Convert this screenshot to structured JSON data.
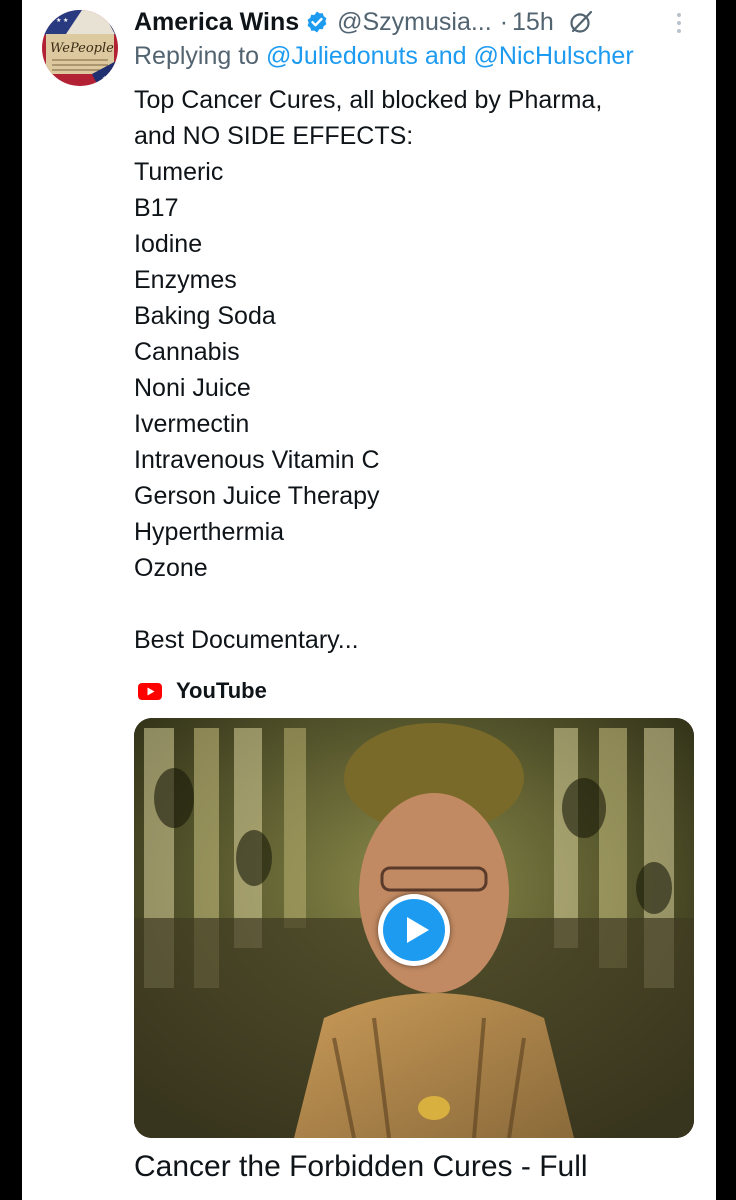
{
  "tweet": {
    "author_name": "America Wins",
    "author_handle": "@Szymusia...",
    "separator": "·",
    "time": "15h",
    "reply_prefix": "Replying to",
    "reply_user1": "@Juliedonuts",
    "reply_and": "and",
    "reply_user2": "@NicHulscher",
    "text_lines": [
      "Top Cancer Cures, all blocked by Pharma,",
      "and NO SIDE EFFECTS:",
      "Tumeric",
      "B17",
      "Iodine",
      "Enzymes",
      "Baking Soda",
      "Cannabis",
      "Noni Juice",
      "Ivermectin",
      "Intravenous Vitamin C",
      "Gerson Juice Therapy",
      "Hyperthermia",
      "Ozone",
      "",
      "Best Documentary..."
    ]
  },
  "link_card": {
    "source": "YouTube",
    "title": "Cancer the Forbidden Cures - Full"
  },
  "icons": {
    "verified": "verified-badge-icon",
    "grok": "grok-icon",
    "more": "more-options-icon",
    "youtube": "youtube-logo-icon",
    "play": "play-icon"
  },
  "colors": {
    "accent": "#1d9bf0",
    "text_primary": "#0f1419",
    "text_secondary": "#536471",
    "youtube_red": "#ff0000"
  }
}
